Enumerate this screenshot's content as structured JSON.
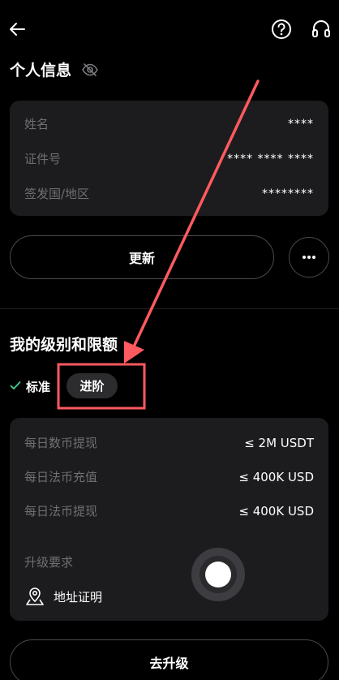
{
  "colors": {
    "background": "#000000",
    "card": "#1c1c1e",
    "muted_text": "#6f6f74",
    "annotation": "#ff5a5f",
    "check": "#3ecf8e"
  },
  "icons": {
    "back": "arrow-left-icon",
    "help": "question-circle-icon",
    "support": "headset-icon",
    "visibility": "eye-off-icon",
    "more": "more-horizontal-icon",
    "check": "check-icon",
    "address": "map-pin-icon"
  },
  "personal_info": {
    "title": "个人信息",
    "rows": [
      {
        "label": "姓名",
        "value": "****"
      },
      {
        "label": "证件号",
        "value": "**** **** ****"
      },
      {
        "label": "签发国/地区",
        "value": "********"
      }
    ],
    "update_label": "更新"
  },
  "limits": {
    "title": "我的级别和限额",
    "tier_standard": "标准",
    "tier_advanced": "进阶",
    "rows": [
      {
        "label": "每日数币提现",
        "value": "≤ 2M USDT"
      },
      {
        "label": "每日法币充值",
        "value": "≤ 400K USD"
      },
      {
        "label": "每日法币提现",
        "value": "≤ 400K USD"
      }
    ],
    "requirements_label": "升级要求",
    "requirement_item": "地址证明",
    "upgrade_label": "去升级"
  }
}
